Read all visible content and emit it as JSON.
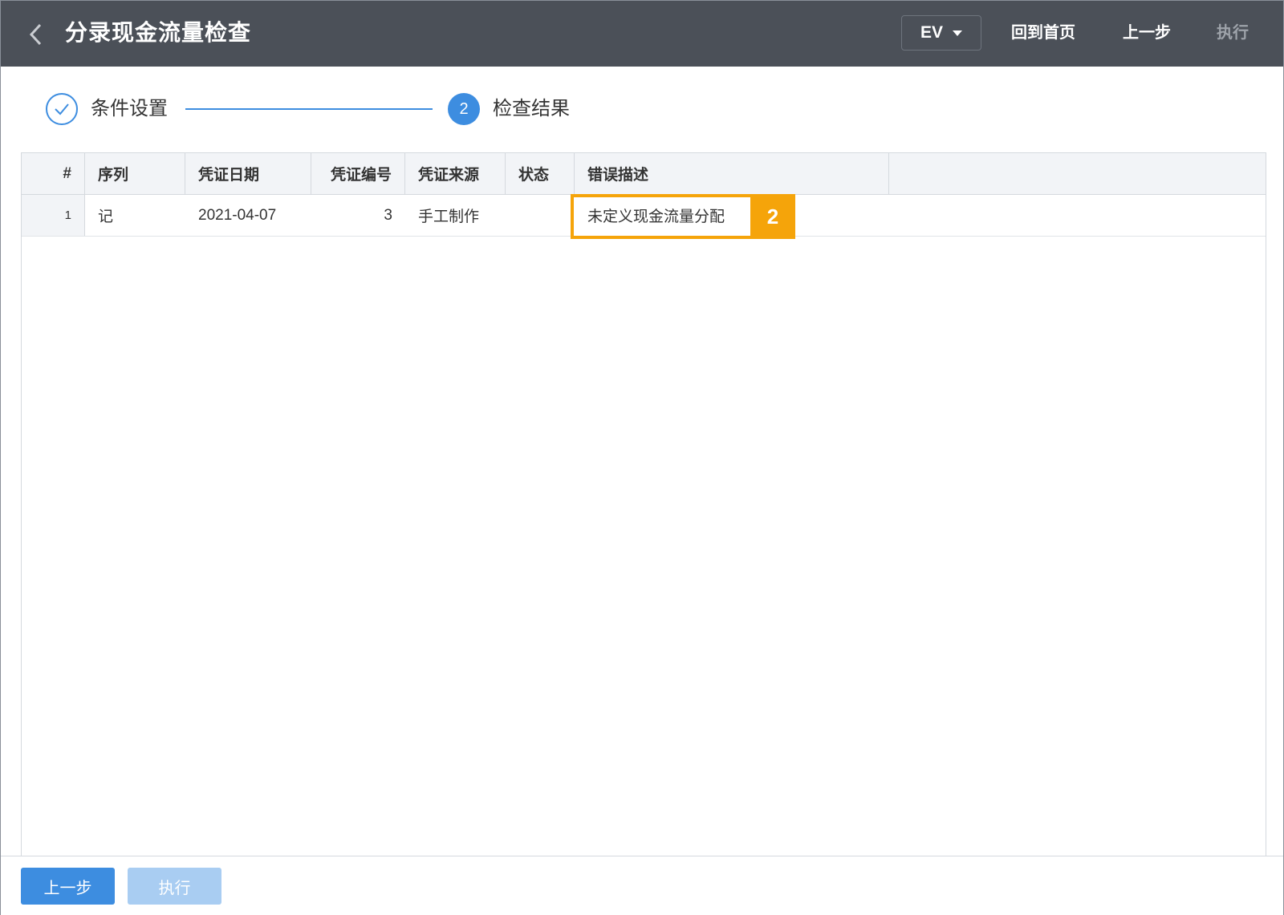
{
  "header": {
    "title": "分录现金流量检查",
    "org_select": "EV",
    "actions": {
      "home": "回到首页",
      "prev": "上一步",
      "execute": "执行"
    }
  },
  "steps": [
    {
      "label": "条件设置",
      "status": "done"
    },
    {
      "number": "2",
      "label": "检查结果",
      "status": "active"
    }
  ],
  "table": {
    "columns": [
      "#",
      "序列",
      "凭证日期",
      "凭证编号",
      "凭证来源",
      "状态",
      "错误描述"
    ],
    "rows": [
      {
        "index": "1",
        "seq": "记",
        "date": "2021-04-07",
        "number": "3",
        "source": "手工制作",
        "status": "",
        "error": "未定义现金流量分配"
      }
    ]
  },
  "annotation": {
    "badge": "2",
    "color": "#f5a40a"
  },
  "footer": {
    "prev_label": "上一步",
    "execute_label": "执行"
  },
  "colors": {
    "topbar": "#4b5058",
    "primary": "#3d8de0",
    "primary_disabled": "#a9cdf2"
  }
}
